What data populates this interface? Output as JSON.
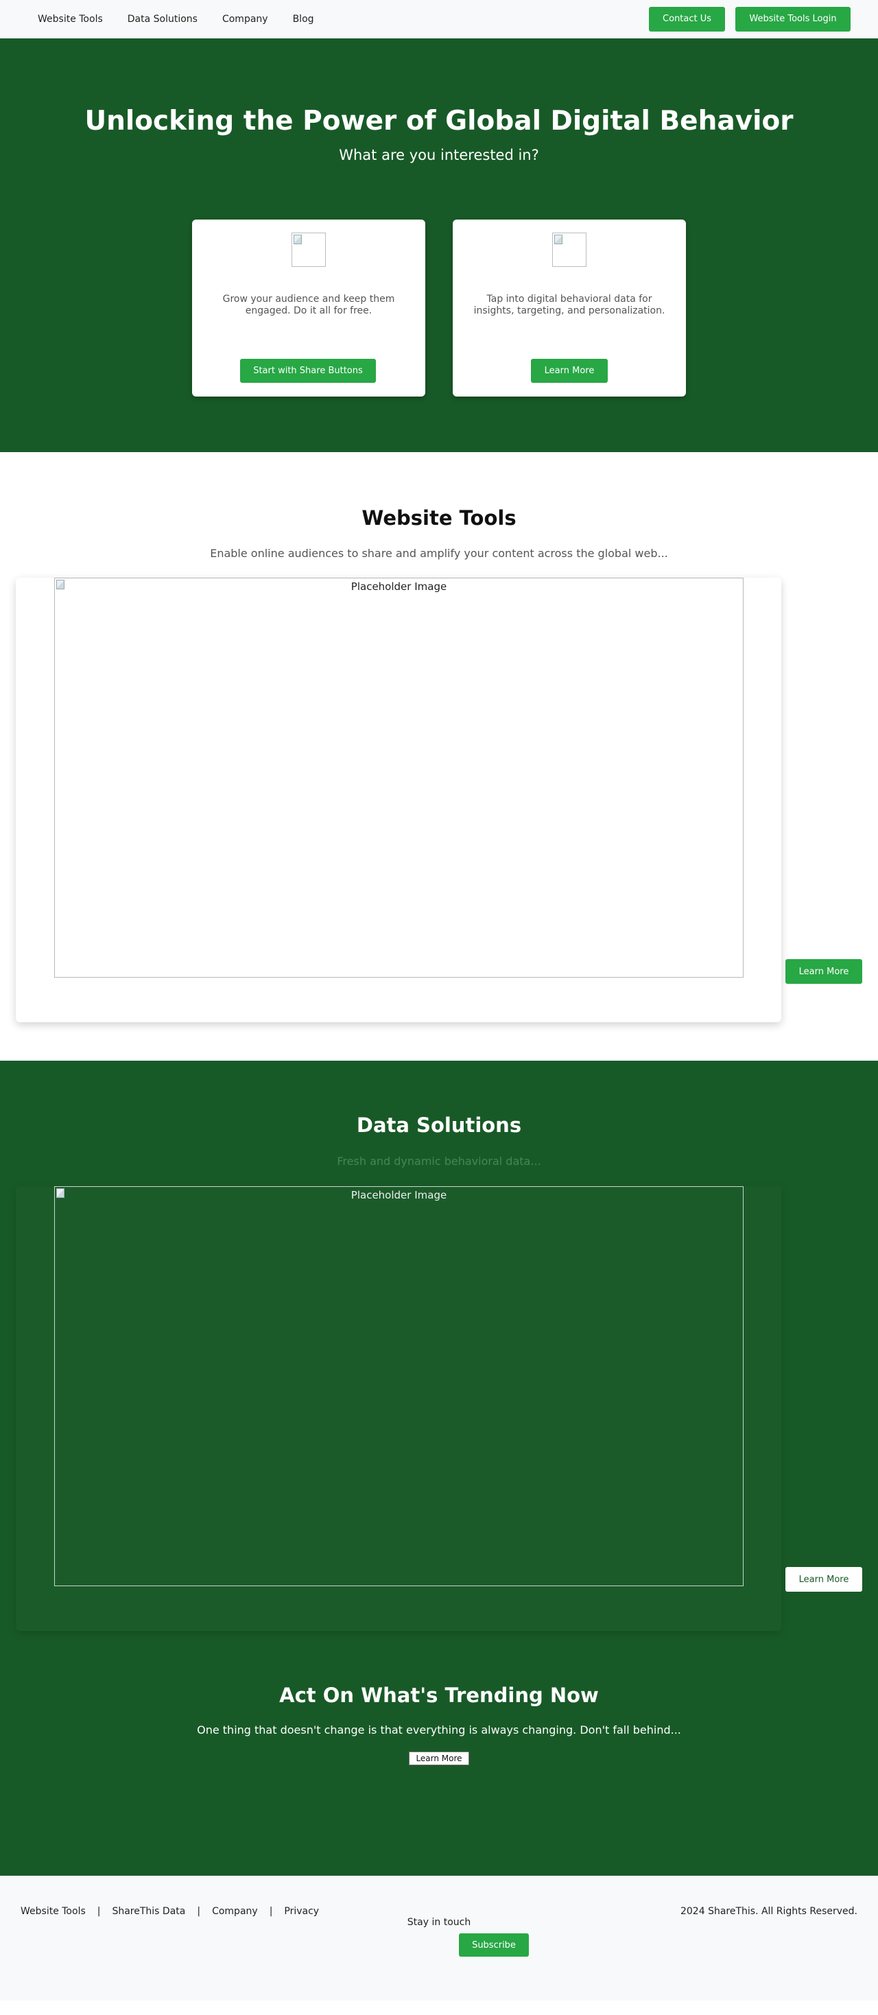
{
  "nav": {
    "links": [
      "Website Tools",
      "Data Solutions",
      "Company",
      "Blog"
    ],
    "contact_label": "Contact Us",
    "login_label": "Website Tools Login"
  },
  "hero": {
    "title": "Unlocking the Power of Global Digital Behavior",
    "subtitle": "What are you interested in?",
    "cards": [
      {
        "text": "Grow your audience and keep them engaged. Do it all for free.",
        "button": "Start with Share Buttons"
      },
      {
        "text": "Tap into digital behavioral data for insights, targeting, and personalization.",
        "button": "Learn More"
      }
    ]
  },
  "website_tools": {
    "title": "Website Tools",
    "subtitle": "Enable online audiences to share and amplify your content across the global web...",
    "image_alt": "Placeholder Image",
    "button": "Learn More"
  },
  "data_solutions": {
    "title": "Data Solutions",
    "subtitle": "Fresh and dynamic behavioral data...",
    "image_alt": "Placeholder Image",
    "button": "Learn More"
  },
  "trending": {
    "title": "Act On What's Trending Now",
    "subtitle": "One thing that doesn't change is that everything is always changing. Don't fall behind...",
    "button": "Learn More"
  },
  "footer": {
    "links": [
      "Website Tools",
      "ShareThis Data",
      "Company",
      "Privacy"
    ],
    "separator": "|",
    "stay_in_touch": "Stay in touch",
    "subscribe": "Subscribe",
    "copyright": "2024 ShareThis. All Rights Reserved."
  },
  "colors": {
    "brand_green": "#185a27",
    "button_green": "#28a745"
  }
}
